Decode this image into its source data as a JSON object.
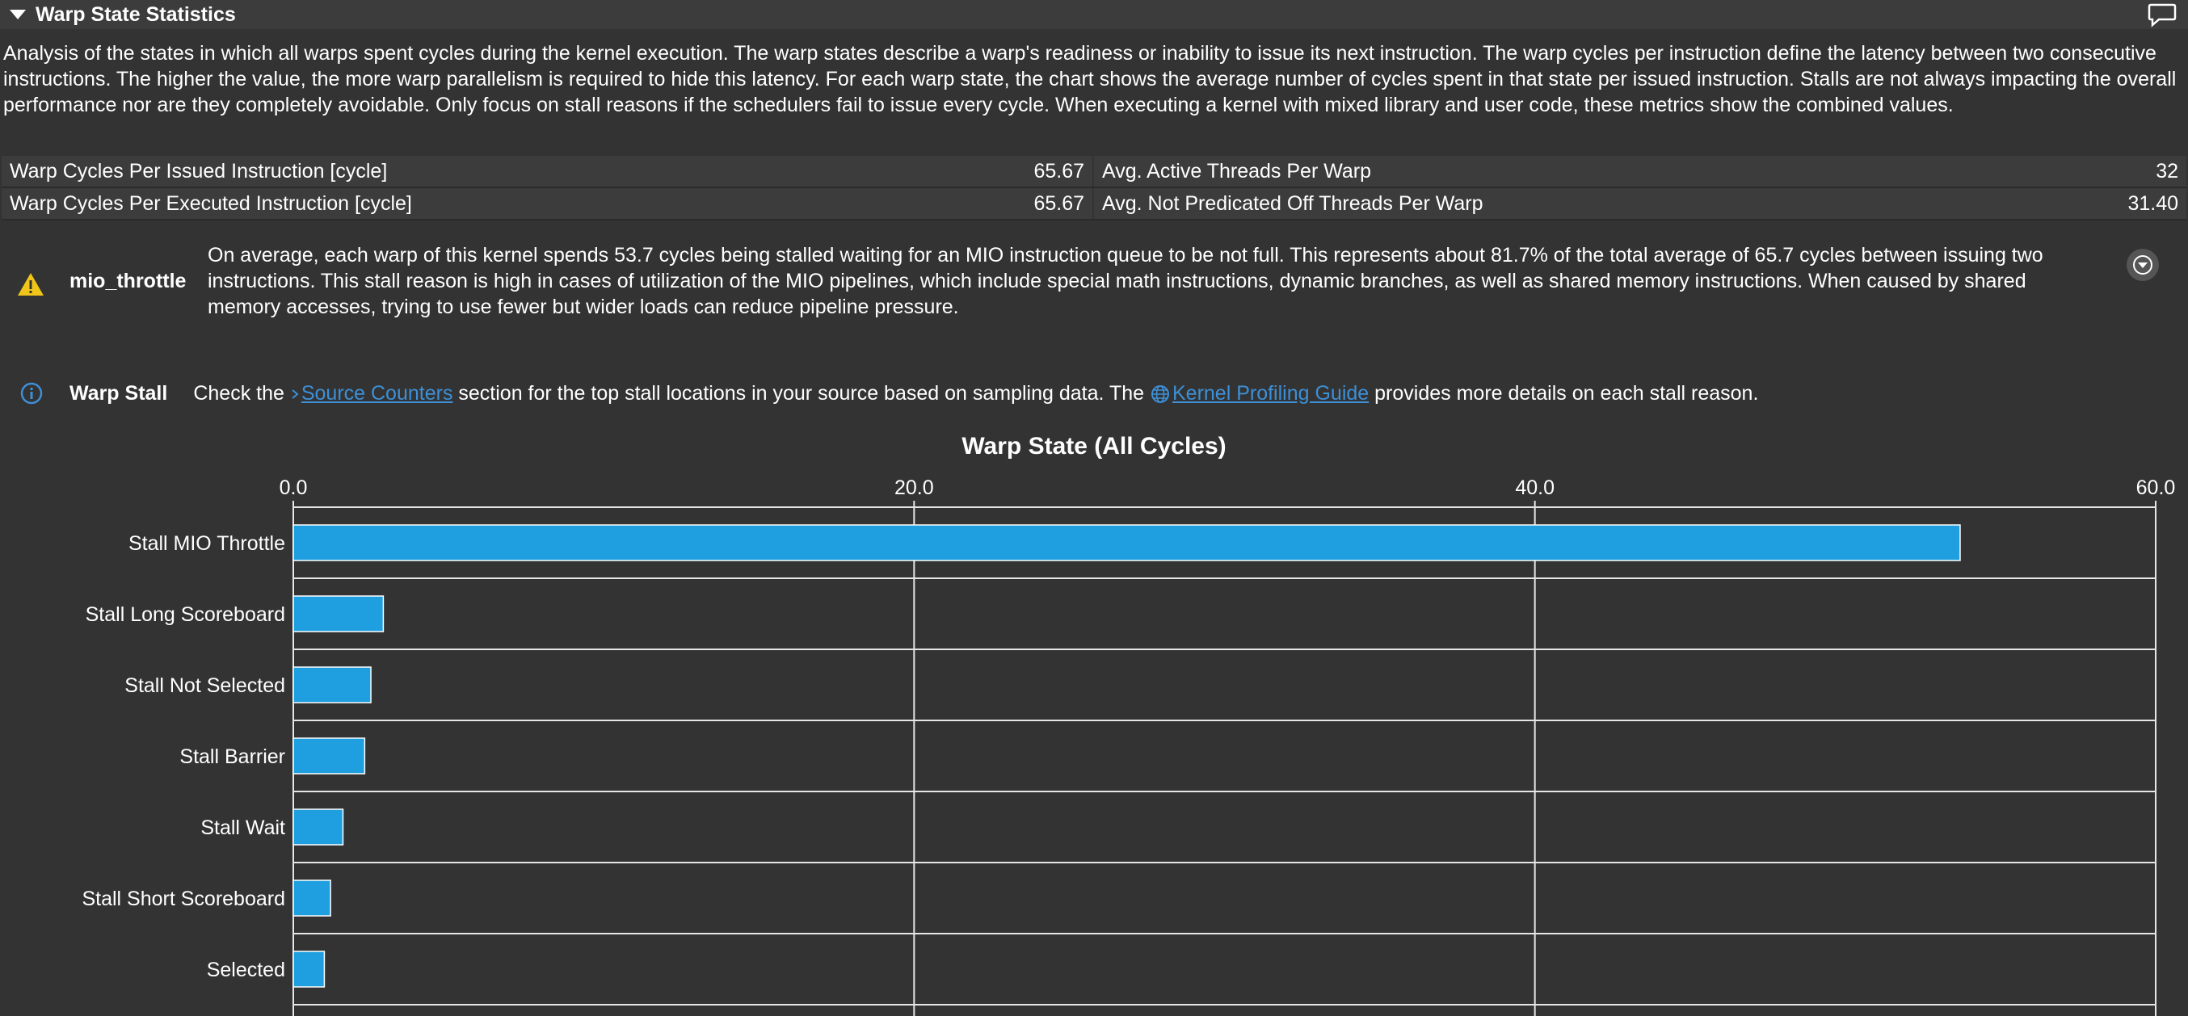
{
  "section": {
    "title": "Warp State Statistics",
    "description": "Analysis of the states in which all warps spent cycles during the kernel execution. The warp states describe a warp's readiness or inability to issue its next instruction. The warp cycles per instruction define the latency between two consecutive instructions. The higher the value, the more warp parallelism is required to hide this latency. For each warp state, the chart shows the average number of cycles spent in that state per issued instruction. Stalls are not always impacting the overall performance nor are they completely avoidable. Only focus on stall reasons if the schedulers fail to issue every cycle. When executing a kernel with mixed library and user code, these metrics show the combined values."
  },
  "metrics": [
    {
      "left_label": "Warp Cycles Per Issued Instruction [cycle]",
      "left_value": "65.67",
      "right_label": "Avg. Active Threads Per Warp",
      "right_value": "32"
    },
    {
      "left_label": "Warp Cycles Per Executed Instruction [cycle]",
      "left_value": "65.67",
      "right_label": "Avg. Not Predicated Off Threads Per Warp",
      "right_value": "31.40"
    }
  ],
  "rule": {
    "name": "mio_throttle",
    "text": "On average, each warp of this kernel spends 53.7 cycles being stalled waiting for an MIO instruction queue to be not full. This represents about 81.7% of the total average of 65.7 cycles between issuing two instructions. This stall reason is high in cases of utilization of the MIO pipelines, which include special math instructions, dynamic branches, as well as shared memory instructions. When caused by shared memory accesses, trying to use fewer but wider loads can reduce pipeline pressure."
  },
  "hint": {
    "name": "Warp Stall",
    "text_before": "Check the ",
    "link1": "Source Counters",
    "text_middle": " section for the top stall locations in your source based on sampling data. The ",
    "link2": "Kernel Profiling Guide",
    "text_after": " provides more details on each stall reason."
  },
  "colors": {
    "background": "#333333",
    "bar": "#1f9fdf",
    "link": "#3d8fd6",
    "warning": "#f0c419",
    "info": "#3d8fd6"
  },
  "chart_data": {
    "type": "bar",
    "title": "Warp State (All Cycles)",
    "orientation": "horizontal",
    "categories": [
      "Stall MIO Throttle",
      "Stall Long Scoreboard",
      "Stall Not Selected",
      "Stall Barrier",
      "Stall Wait",
      "Stall Short Scoreboard",
      "Selected"
    ],
    "values": [
      53.7,
      2.9,
      2.5,
      2.3,
      1.6,
      1.2,
      1.0
    ],
    "xlim": [
      0,
      60
    ],
    "ticks": [
      "0.0",
      "20.0",
      "40.0",
      "60.0"
    ],
    "tick_values": [
      0,
      20,
      40,
      60
    ],
    "grid": true
  }
}
